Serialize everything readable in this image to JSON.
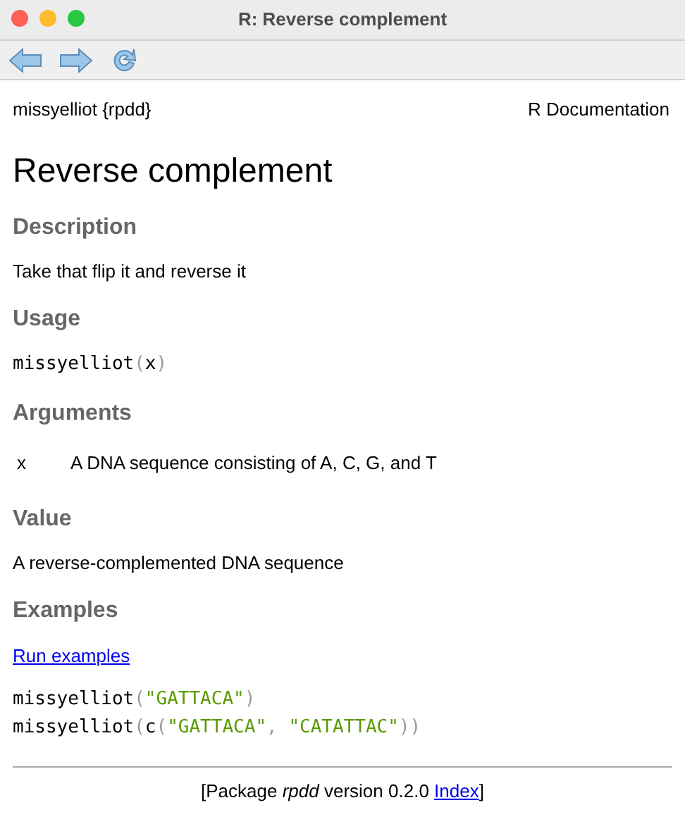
{
  "window": {
    "title": "R: Reverse complement"
  },
  "toolbar": {
    "buttons": [
      {
        "kind": "back"
      },
      {
        "kind": "forward"
      },
      {
        "kind": "reload"
      }
    ]
  },
  "header": {
    "topic": "missyelliot {rpdd}",
    "label": "R Documentation"
  },
  "title": "Reverse complement",
  "sections": [
    {
      "heading": "Description",
      "kind": "text",
      "text": "Take that flip it and reverse it"
    },
    {
      "heading": "Usage",
      "kind": "code",
      "lines": [
        [
          {
            "text": "missyelliot",
            "kind": "plain"
          },
          {
            "text": "(",
            "kind": "punct"
          },
          {
            "text": "x",
            "kind": "plain"
          },
          {
            "text": ")",
            "kind": "punct"
          }
        ]
      ]
    },
    {
      "heading": "Arguments",
      "kind": "args",
      "args": [
        {
          "name": "x",
          "description": "A DNA sequence consisting of A, C, G, and T"
        }
      ]
    },
    {
      "heading": "Value",
      "kind": "text",
      "text": "A reverse-complemented DNA sequence"
    },
    {
      "heading": "Examples",
      "kind": "examples",
      "link": "Run examples",
      "lines": [
        [
          {
            "text": "missyelliot",
            "kind": "plain"
          },
          {
            "text": "(",
            "kind": "punct"
          },
          {
            "text": "\"GATTACA\"",
            "kind": "string"
          },
          {
            "text": ")",
            "kind": "punct"
          }
        ],
        [
          {
            "text": "missyelliot",
            "kind": "plain"
          },
          {
            "text": "(",
            "kind": "punct"
          },
          {
            "text": "c",
            "kind": "plain"
          },
          {
            "text": "(",
            "kind": "punct"
          },
          {
            "text": "\"GATTACA\"",
            "kind": "string"
          },
          {
            "text": ", ",
            "kind": "punct"
          },
          {
            "text": "\"CATATTAC\"",
            "kind": "string"
          },
          {
            "text": "))",
            "kind": "punct"
          }
        ]
      ]
    }
  ],
  "footer": {
    "text": "[Package *rpdd* version 0.2.0 ",
    "link": "Index",
    "end": "]"
  }
}
